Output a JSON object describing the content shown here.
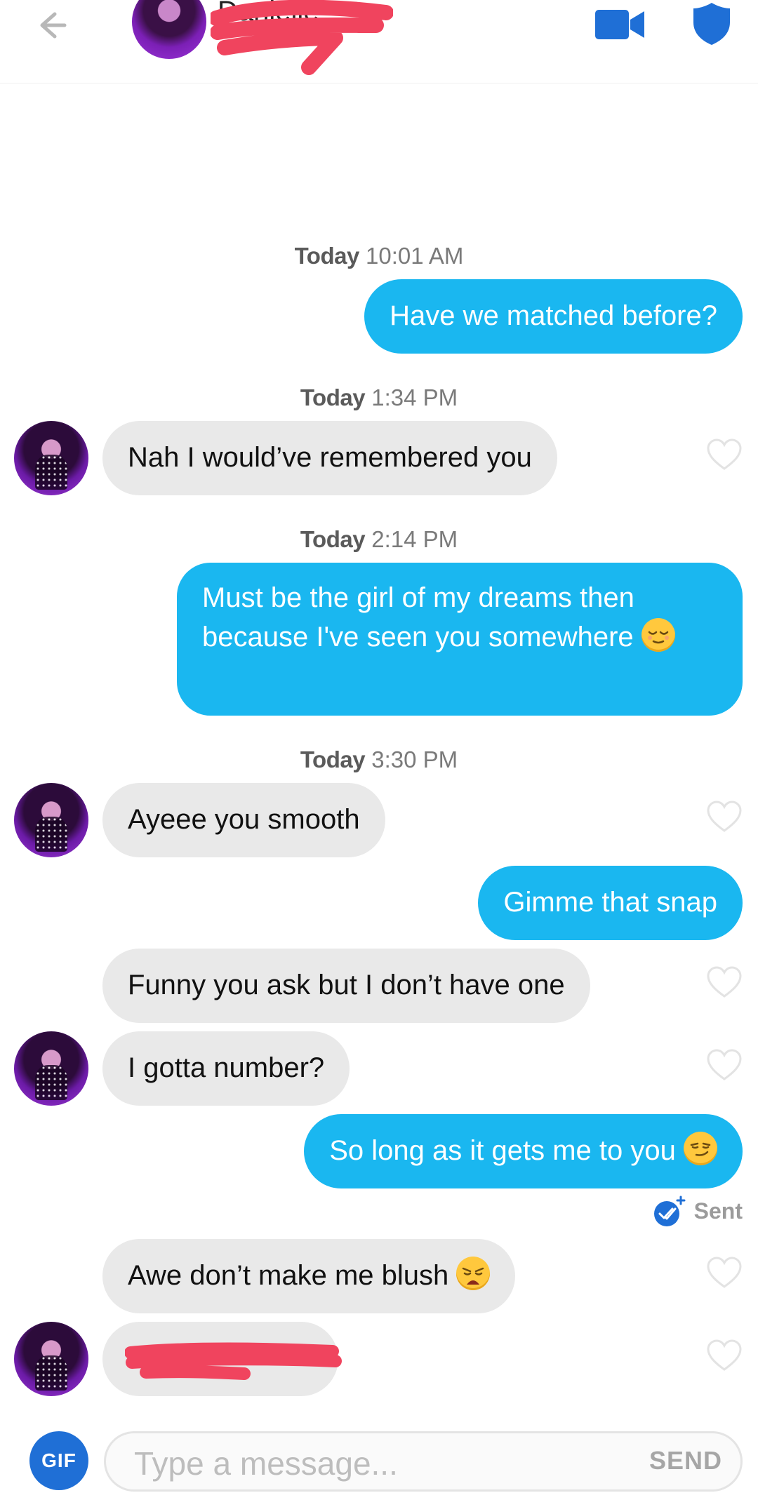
{
  "header": {
    "contact_name": "Danielle",
    "back_icon": "arrow-left-icon",
    "video_icon": "video-camera-icon",
    "safety_icon": "shield-icon",
    "accent_color": "#1f6fd6"
  },
  "messages": [
    {
      "type": "timestamp",
      "day": "Today",
      "time": "10:01 AM"
    },
    {
      "type": "outgoing",
      "text": "Have we matched before?"
    },
    {
      "type": "timestamp",
      "day": "Today",
      "time": "1:34 PM"
    },
    {
      "type": "incoming",
      "text": "Nah I would’ve remembered you"
    },
    {
      "type": "timestamp",
      "day": "Today",
      "time": "2:14 PM"
    },
    {
      "type": "outgoing",
      "text": "Must be the girl of my dreams then because I've seen you somewhere"
    },
    {
      "type": "timestamp",
      "day": "Today",
      "time": "3:30 PM"
    },
    {
      "type": "incoming",
      "text": "Ayeee you smooth"
    },
    {
      "type": "outgoing",
      "text": "Gimme that snap"
    },
    {
      "type": "incoming",
      "text": "Funny you ask but I don’t have one"
    },
    {
      "type": "incoming",
      "text": "I gotta number?"
    },
    {
      "type": "outgoing",
      "text": "So long as it gets me to you"
    },
    {
      "type": "incoming",
      "text": "Awe don’t make me blush"
    },
    {
      "type": "incoming",
      "text": ""
    }
  ],
  "status": {
    "sent_label": "Sent"
  },
  "emojis": {
    "relieved": "relieved-face-emoji",
    "smirk": "smirking-face-emoji",
    "weary": "weary-face-emoji"
  },
  "composer": {
    "gif_label": "GIF",
    "placeholder": "Type a message...",
    "send_label": "SEND"
  },
  "colors": {
    "outgoing_bubble": "#1ab7f0",
    "incoming_bubble": "#e9e9e9",
    "like_heart": "#e3e3e3"
  }
}
